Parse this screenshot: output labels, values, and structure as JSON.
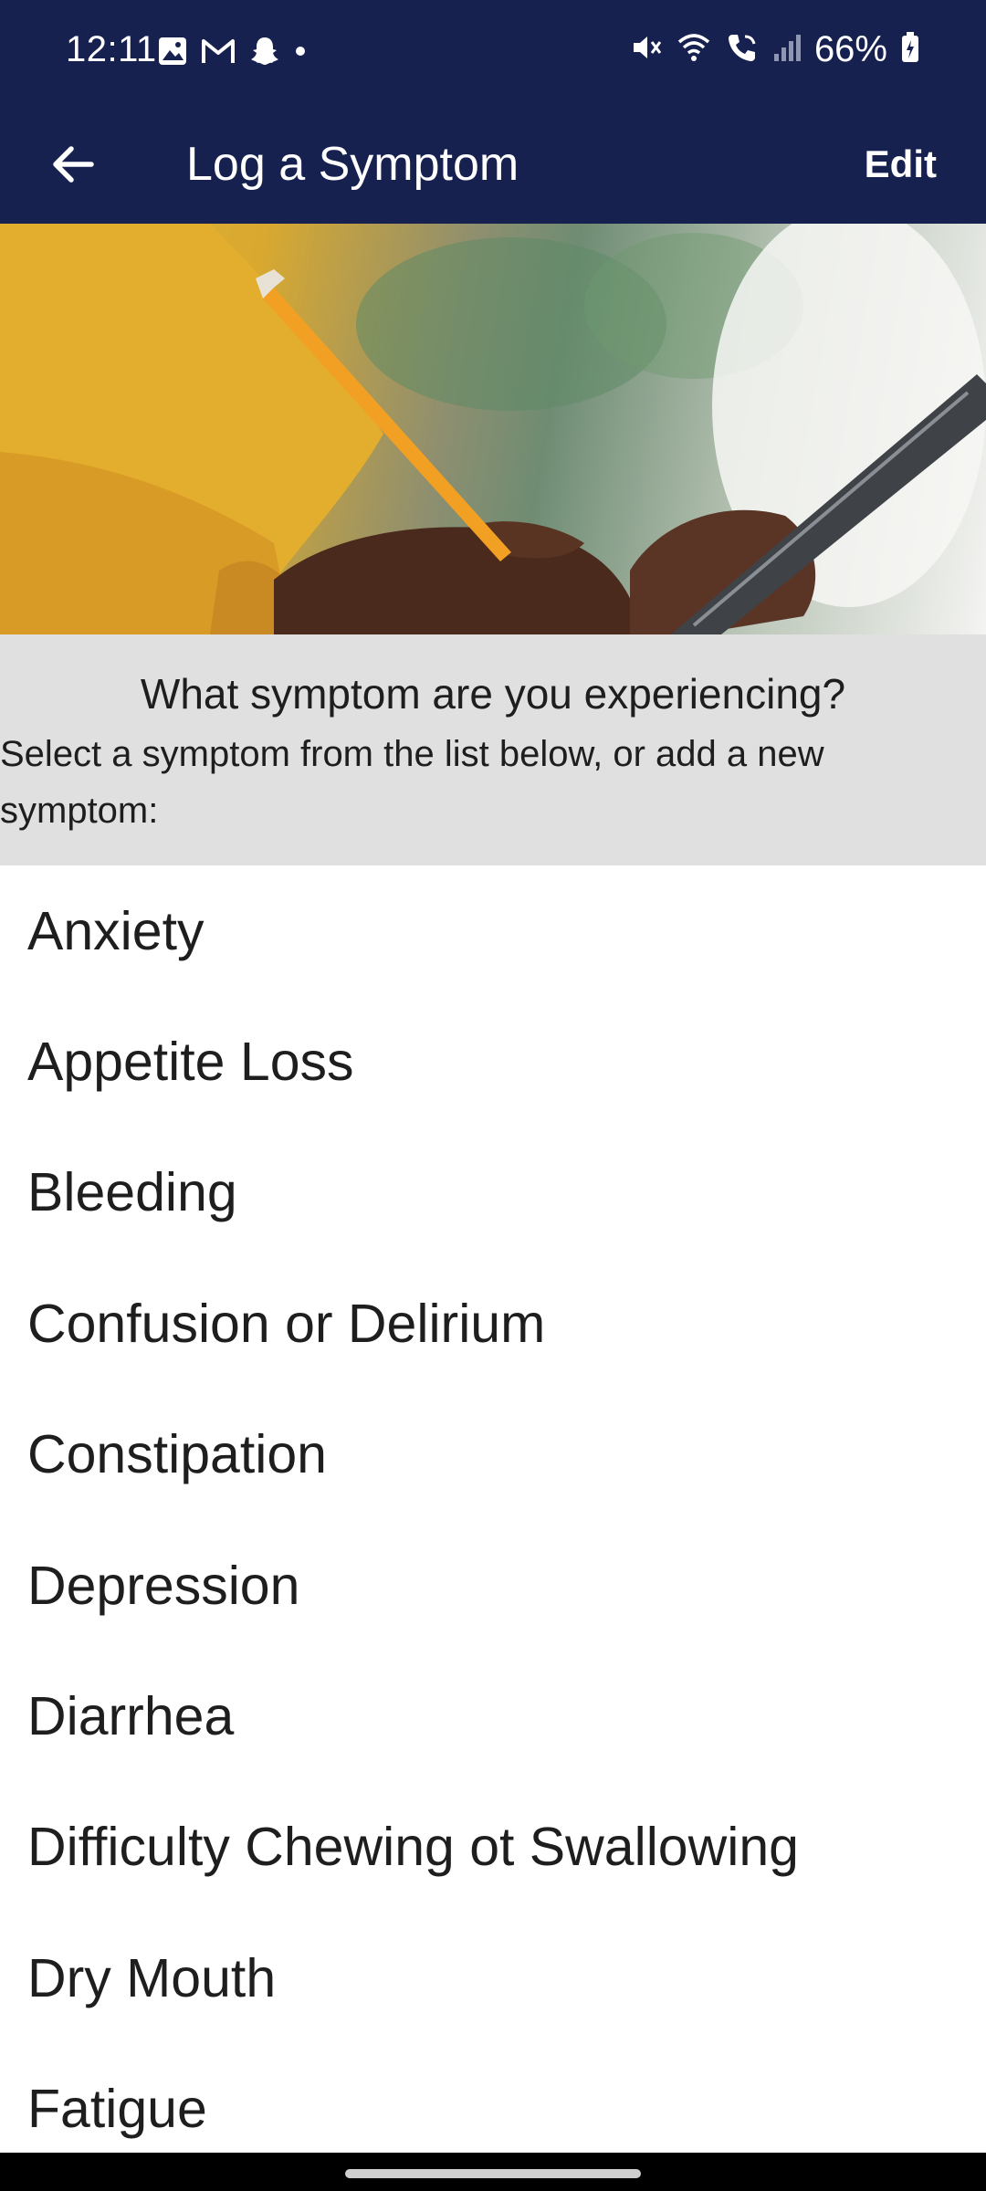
{
  "status_bar": {
    "time": "12:11",
    "battery": "66%",
    "left_icons": [
      "gallery-icon",
      "gmail-icon",
      "snapchat-icon",
      "dot-icon"
    ],
    "right_icons": [
      "mute-icon",
      "wifi-icon",
      "wifi-call-icon",
      "signal-icon",
      "battery-icon"
    ]
  },
  "app_bar": {
    "title": "Log a Symptom",
    "edit_label": "Edit",
    "back_icon": "arrow-left-icon"
  },
  "prompt": {
    "question": "What symptom are you experiencing?",
    "instruction": "Select a symptom from the list below, or add a new symptom:"
  },
  "symptoms": [
    "Anxiety",
    "Appetite Loss",
    "Bleeding",
    "Confusion or Delirium",
    "Constipation",
    "Depression",
    "Diarrhea",
    "Difficulty Chewing ot Swallowing",
    "Dry Mouth",
    "Fatigue"
  ],
  "colors": {
    "header": "#16214f",
    "prompt_background": "#e0e0e0",
    "text": "#1e1e1e"
  }
}
